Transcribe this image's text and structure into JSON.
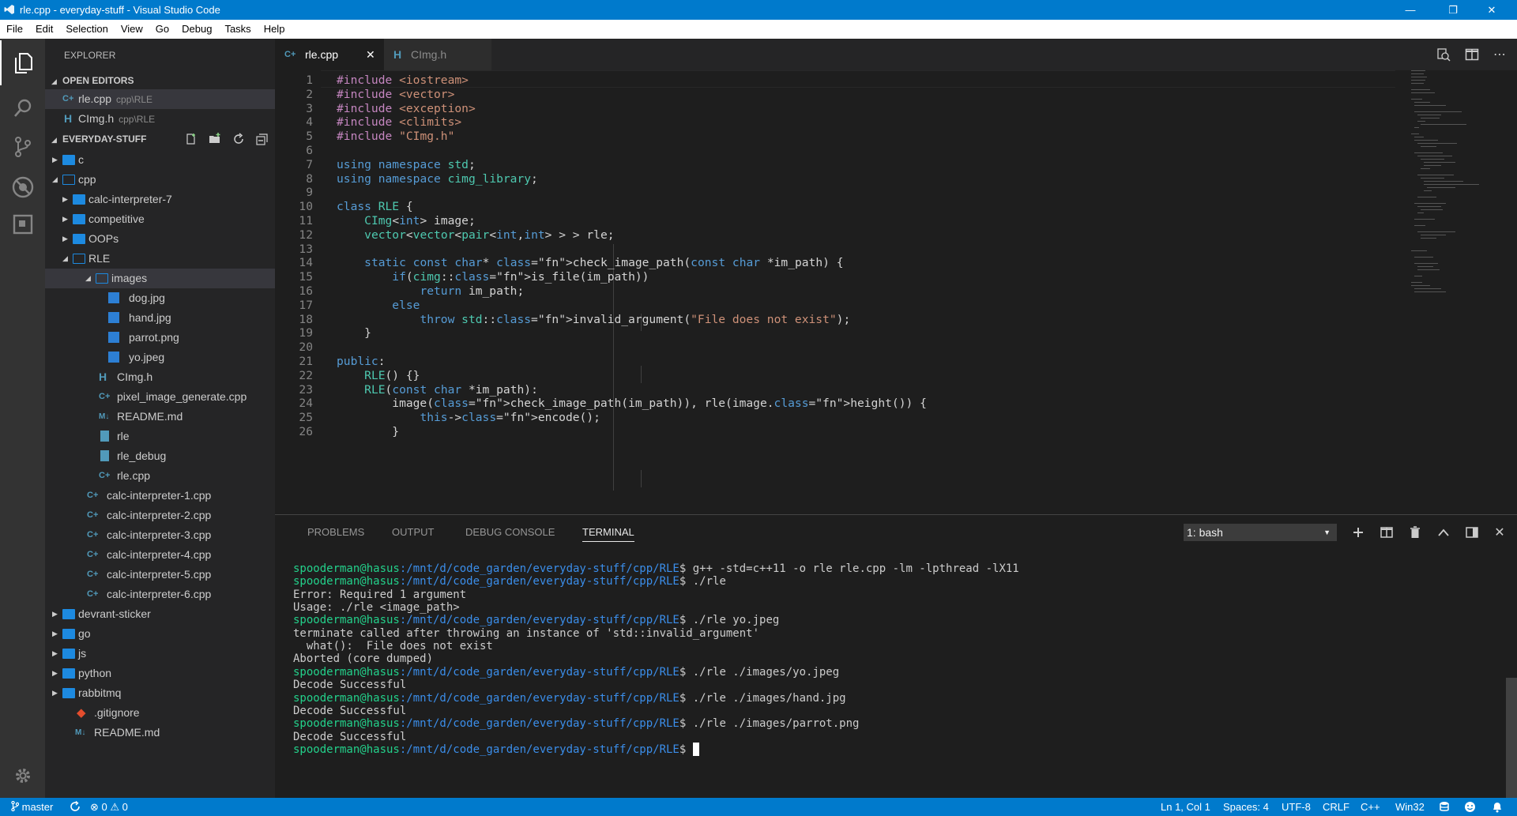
{
  "window": {
    "title": "rle.cpp - everyday-stuff - Visual Studio Code"
  },
  "menu": [
    "File",
    "Edit",
    "Selection",
    "View",
    "Go",
    "Debug",
    "Tasks",
    "Help"
  ],
  "explorer": {
    "title": "EXPLORER",
    "open_editors_title": "OPEN EDITORS",
    "open_editors": [
      {
        "name": "rle.cpp",
        "path": "cpp\\RLE",
        "icon": "cpp-file-icon"
      },
      {
        "name": "CImg.h",
        "path": "cpp\\RLE",
        "icon": "header-file-icon"
      }
    ],
    "workspace_title": "EVERYDAY-STUFF",
    "tree": [
      "c",
      "cpp",
      "calc-interpreter-7",
      "competitive",
      "OOPs",
      "RLE",
      "images",
      "dog.jpg",
      "hand.jpg",
      "parrot.png",
      "yo.jpeg",
      "CImg.h",
      "pixel_image_generate.cpp",
      "README.md",
      "rle",
      "rle_debug",
      "rle.cpp",
      "calc-interpreter-1.cpp",
      "calc-interpreter-2.cpp",
      "calc-interpreter-3.cpp",
      "calc-interpreter-4.cpp",
      "calc-interpreter-5.cpp",
      "calc-interpreter-6.cpp",
      "devrant-sticker",
      "go",
      "js",
      "python",
      "rabbitmq",
      ".gitignore",
      "README.md"
    ]
  },
  "tabs": [
    {
      "label": "rle.cpp",
      "active": true
    },
    {
      "label": "CImg.h",
      "active": false
    }
  ],
  "editor": {
    "line_numbers": [
      "1",
      "2",
      "3",
      "4",
      "5",
      "6",
      "7",
      "8",
      "9",
      "10",
      "11",
      "12",
      "13",
      "14",
      "15",
      "16",
      "17",
      "18",
      "19",
      "20",
      "21",
      "22",
      "23",
      "24",
      "25",
      "26"
    ],
    "lines": [
      "#include <iostream>",
      "#include <vector>",
      "#include <exception>",
      "#include <climits>",
      "#include \"CImg.h\"",
      "",
      "using namespace std;",
      "using namespace cimg_library;",
      "",
      "class RLE {",
      "    CImg<int> image;",
      "    vector<vector<pair<int,int> > > rle;",
      "",
      "    static const char* check_image_path(const char *im_path) {",
      "        if(cimg::is_file(im_path))",
      "            return im_path;",
      "        else",
      "            throw std::invalid_argument(\"File does not exist\");",
      "    }",
      "",
      "public:",
      "    RLE() {}",
      "    RLE(const char *im_path):",
      "        image(check_image_path(im_path)), rle(image.height()) {",
      "            this->encode();",
      "        }"
    ]
  },
  "panel": {
    "tabs": [
      "PROBLEMS",
      "OUTPUT",
      "DEBUG CONSOLE",
      "TERMINAL"
    ],
    "active_tab": "TERMINAL",
    "terminal_select": "1: bash",
    "prompt_user": "spooderman@hasus",
    "prompt_path": ":/mnt/d/code_garden/everyday-stuff/cpp/RLE",
    "lines": [
      {
        "type": "cmd",
        "text": "$ g++ -std=c++11 -o rle rle.cpp -lm -lpthread -lX11"
      },
      {
        "type": "cmd",
        "text": "$ ./rle"
      },
      {
        "type": "out",
        "text": "Error: Required 1 argument"
      },
      {
        "type": "out",
        "text": "Usage: ./rle <image_path>"
      },
      {
        "type": "cmd",
        "text": "$ ./rle yo.jpeg"
      },
      {
        "type": "out",
        "text": "terminate called after throwing an instance of 'std::invalid_argument'"
      },
      {
        "type": "out",
        "text": "  what():  File does not exist"
      },
      {
        "type": "out",
        "text": "Aborted (core dumped)"
      },
      {
        "type": "cmd",
        "text": "$ ./rle ./images/yo.jpeg"
      },
      {
        "type": "out",
        "text": "Decode Successful"
      },
      {
        "type": "cmd",
        "text": "$ ./rle ./images/hand.jpg"
      },
      {
        "type": "out",
        "text": "Decode Successful"
      },
      {
        "type": "cmd",
        "text": "$ ./rle ./images/parrot.png"
      },
      {
        "type": "out",
        "text": "Decode Successful"
      },
      {
        "type": "cmd",
        "text": "$ "
      }
    ]
  },
  "status": {
    "branch": "master",
    "errors": "0",
    "warnings": "0",
    "position": "Ln 1, Col 1",
    "spaces": "Spaces: 4",
    "encoding": "UTF-8",
    "eol": "CRLF",
    "language": "C++",
    "platform": "Win32"
  },
  "colors": {
    "accent": "#007acc",
    "keyword": "#569cd6",
    "preprocessor": "#c586c0",
    "string": "#ce9178",
    "function": "#dcdcaa",
    "type": "#4ec9b0",
    "prompt_user": "#23d18b",
    "prompt_path": "#3b8eea"
  }
}
